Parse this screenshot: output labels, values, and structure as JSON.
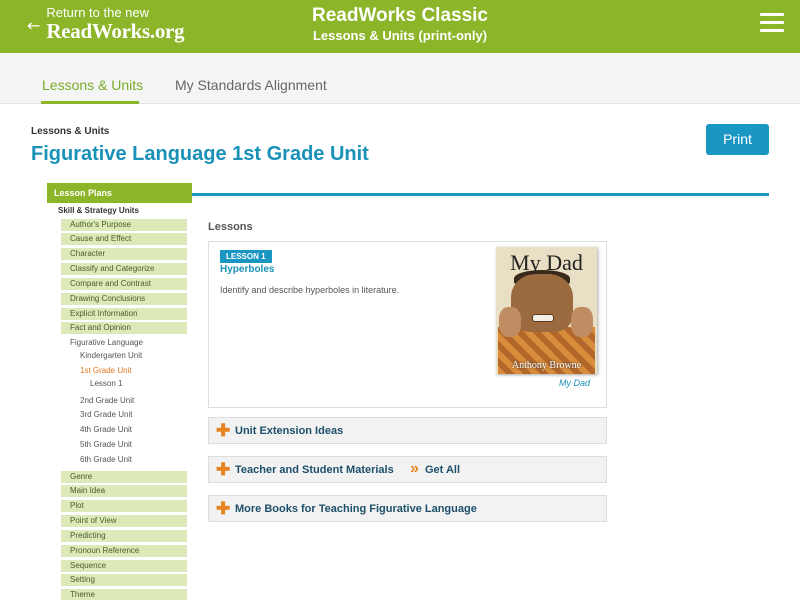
{
  "topbar": {
    "back_line1": "Return to the new",
    "back_line2": "ReadWorks.org",
    "back_arrow": "←",
    "title": "ReadWorks Classic",
    "subtitle": "Lessons & Units (print-only)",
    "menu_icon": "hamburger-icon"
  },
  "subnav": {
    "tabs": [
      {
        "label": "Lessons & Units",
        "active": true
      },
      {
        "label": "My Standards Alignment",
        "active": false
      }
    ]
  },
  "page": {
    "breadcrumb": "Lessons & Units",
    "title": "Figurative Language 1st Grade Unit",
    "print_label": "Print"
  },
  "sidebar": {
    "header": "Lesson Plans",
    "section": "Skill & Strategy Units",
    "items_top": [
      "Author's Purpose",
      "Cause and Effect",
      "Character",
      "Classify and Categorize",
      "Compare and Contrast",
      "Drawing Conclusions",
      "Explicit Information",
      "Fact and Opinion"
    ],
    "current_unit": "Figurative Language",
    "grades_before": [
      "Kindergarten Unit"
    ],
    "current_grade": "1st Grade Unit",
    "current_lesson": "Lesson 1",
    "grades_after": [
      "2nd Grade Unit",
      "3rd Grade Unit",
      "4th Grade Unit",
      "5th Grade Unit",
      "6th Grade Unit"
    ],
    "items_bottom": [
      "Genre",
      "Main Idea",
      "Plot",
      "Point of View",
      "Predicting",
      "Pronoun Reference",
      "Sequence",
      "Setting",
      "Theme"
    ]
  },
  "main": {
    "lessons_heading": "Lessons",
    "lesson": {
      "badge": "LESSON 1",
      "name": "Hyperboles",
      "description": "Identify and describe hyperboles in literature.",
      "book_cover_title": "My Dad",
      "book_cover_author": "Anthony Browne",
      "book_caption": "My Dad"
    },
    "accordions": [
      {
        "label": "Unit Extension Ideas",
        "icon": "plus-icon"
      },
      {
        "label": "Teacher and Student Materials",
        "icon": "plus-icon",
        "extra_icon": "double-chevron-right-icon",
        "extra_label": "Get All"
      },
      {
        "label": "More Books for Teaching Figurative Language",
        "icon": "plus-icon"
      }
    ]
  },
  "colors": {
    "brand_green": "#8db52a",
    "accent_blue": "#1a96c2",
    "accent_orange": "#e6831f",
    "sidebar_item_bg": "#dde9b8"
  }
}
